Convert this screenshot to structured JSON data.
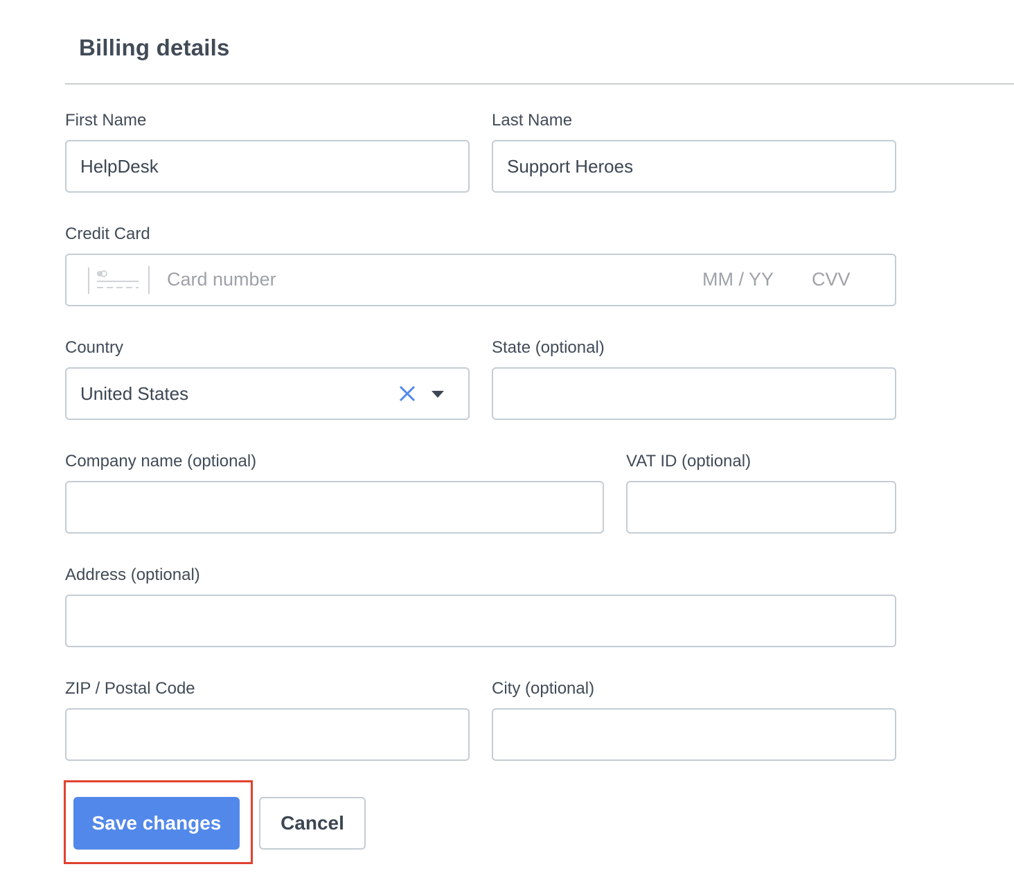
{
  "header": {
    "title": "Billing details"
  },
  "form": {
    "first_name": {
      "label": "First Name",
      "value": "HelpDesk"
    },
    "last_name": {
      "label": "Last Name",
      "value": "Support Heroes"
    },
    "credit_card": {
      "label": "Credit Card",
      "icon": "credit-card-icon",
      "number_placeholder": "Card number",
      "expiry_placeholder": "MM / YY",
      "cvv_placeholder": "CVV"
    },
    "country": {
      "label": "Country",
      "value": "United States",
      "clear_icon": "close-icon",
      "dropdown_icon": "caret-down-icon"
    },
    "state": {
      "label": "State (optional)",
      "value": ""
    },
    "company": {
      "label": "Company name (optional)",
      "value": ""
    },
    "vat": {
      "label": "VAT ID (optional)",
      "value": ""
    },
    "address": {
      "label": "Address (optional)",
      "value": ""
    },
    "zip": {
      "label": "ZIP / Postal Code",
      "value": ""
    },
    "city": {
      "label": "City (optional)",
      "value": ""
    }
  },
  "actions": {
    "save_label": "Save changes",
    "cancel_label": "Cancel"
  },
  "colors": {
    "primary": "#5288ea",
    "highlight": "#e0412f",
    "border": "#c4ccd4",
    "text": "#3c4653"
  }
}
